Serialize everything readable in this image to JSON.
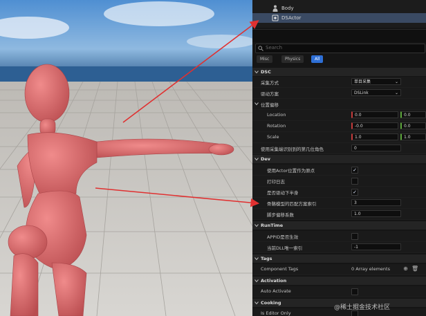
{
  "outliner": {
    "items": [
      {
        "label": "Body",
        "icon": "person-icon"
      },
      {
        "label": "DSActor",
        "icon": "actor-icon"
      }
    ]
  },
  "details": {
    "search_placeholder": "Search",
    "filters": [
      "Misc",
      "Physics",
      "All"
    ],
    "active_filter": "All"
  },
  "sections": {
    "dsc": {
      "title": "DSC",
      "capture_mode_label": "采集方式",
      "capture_mode_value": "单目采集",
      "driver_label": "驱动方案",
      "driver_value": "DSLink",
      "offset_label": "位置偏移",
      "location_label": "Location",
      "location_x": "0.0",
      "location_y": "0.0",
      "rotation_label": "Rotation",
      "rotation_x": "-0.0",
      "rotation_y": "0.0",
      "scale_label": "Scale",
      "scale_x": "1.0",
      "scale_y": "1.0",
      "role_label": "使用采集端识别到的第几位角色",
      "role_value": "0"
    },
    "dev": {
      "title": "Dev",
      "actor_origin_label": "使用Actor位置作为原点",
      "log_label": "打印日志",
      "lower_body_label": "是否驱动下半身",
      "bone_match_label": "骨骼模型的匹配方案索引",
      "bone_match_value": "3",
      "step_factor_label": "脚步偏移系数",
      "step_factor_value": "1.0"
    },
    "runtime": {
      "title": "RunTime",
      "appid_label": "APPID是否生效",
      "dll_label": "当前DLL唯一索引",
      "dll_value": "-1"
    },
    "tags": {
      "title": "Tags",
      "component_tags_label": "Component Tags",
      "component_tags_value": "0 Array elements"
    },
    "activation": {
      "title": "Activation",
      "auto_activate_label": "Auto Activate"
    },
    "cooking": {
      "title": "Cooking",
      "editor_only_label": "Is Editor Only"
    }
  },
  "watermark": "@稀土掘金技术社区",
  "colors": {
    "selection": "#3a4a63",
    "accent": "#2e6fd6",
    "arrow": "#e03030",
    "mannequin": "#d86a6a"
  }
}
